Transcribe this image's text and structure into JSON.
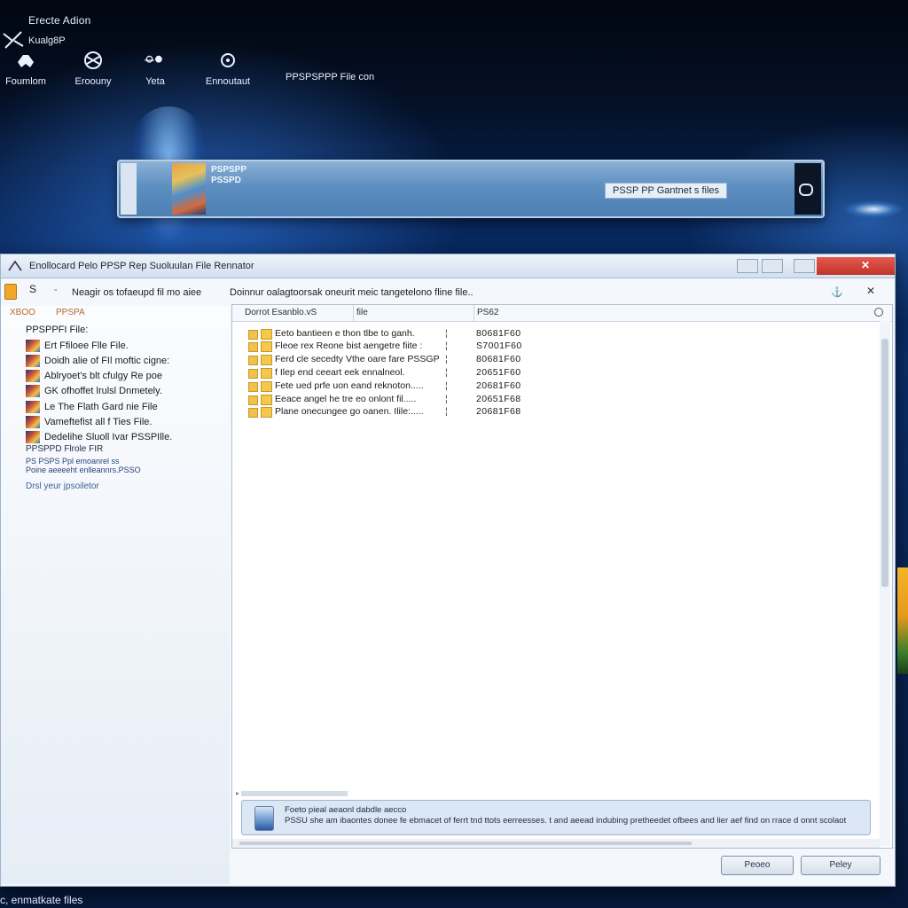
{
  "desktop": {
    "brand": "Erecte Adion",
    "brand_sub": "Kualg8P",
    "tools": [
      {
        "label": "Foumlom",
        "icon": "controller-icon"
      },
      {
        "label": "Eroouny",
        "icon": "globe-icon"
      },
      {
        "label": "Yeta",
        "icon": "people-icon"
      },
      {
        "label": "Ennoutaut",
        "icon": "gear-icon"
      }
    ],
    "file_label": "PPSPSPPP File con"
  },
  "banner": {
    "title_line1": "PSPSPP",
    "title_line2": "PSSPD",
    "chip": "PSSP PP Gantnet s files"
  },
  "window": {
    "title": "Enollocard Pelo PPSP Rep Suoluulan File Rennator",
    "toolbar": {
      "back": "S",
      "dash": "-",
      "path": "Neagir os tofaeupd fil mo aiee",
      "info": "Doinnur oalagtoorsak oneurit meic tangetelono fline file..",
      "right1": "⚓",
      "right2": "✕"
    },
    "sidebar": {
      "head1": "XBOO",
      "head2": "PPSPA",
      "group": "PPSPPFI File:",
      "items": [
        "Ert Ffiloee Flle File.",
        "Doidh alie of FIl moftic cigne:",
        "Ablryoet's blt cfulgy Re poe",
        "GK ofhoffet lrulsl Dnmetely.",
        "Le The Flath Gard nie File",
        "Vameftefist all f Ties File.",
        "Dedelihe Sluoll Ivar PSSPIlle."
      ],
      "section": "PPSPPD Flrole FIR",
      "sub1": "PS PSPS Ppl emoanrel ss",
      "sub2": "Poine aeeeeht enlleannrs.PSSO",
      "link": "Drsl yeur jpsoiletor"
    },
    "columns": [
      "Dorrot Esanblo.vS",
      "file",
      "PS62"
    ],
    "rows": [
      {
        "name": "Eeto bantieen e thon tlbe to ganh.",
        "size": "80681F60"
      },
      {
        "name": "Fleoe rex Reone bist aengetre fiite :",
        "size": "S7001F60"
      },
      {
        "name": "Ferd cle secedty Vthe oare fare PSSGP",
        "size": "80681F60"
      },
      {
        "name": "f Ilep end ceeart eek ennalneol.",
        "size": "20651F60"
      },
      {
        "name": "Fete ued prfe uon eand reknoton.....",
        "size": "20681F60"
      },
      {
        "name": "Eeace angel he tre eo onlont fil.....",
        "size": "20651F68"
      },
      {
        "name": "Plane onecungee go oanen. Ilile:.....",
        "size": "20681F68"
      }
    ],
    "info": {
      "line1": "Foeto pieal aeaonl dabdle aecco",
      "line2": "PSSU she am ibaontes donee fe ebmacet of ferrt tnd ttots eerreesses. t and aeead indubing pretheedet ofbees and lier aef find on rrace d onnt scolaot"
    },
    "buttons": {
      "primary": "Peoeo",
      "secondary": "Peley"
    }
  },
  "footer": "c, enmatkate files"
}
